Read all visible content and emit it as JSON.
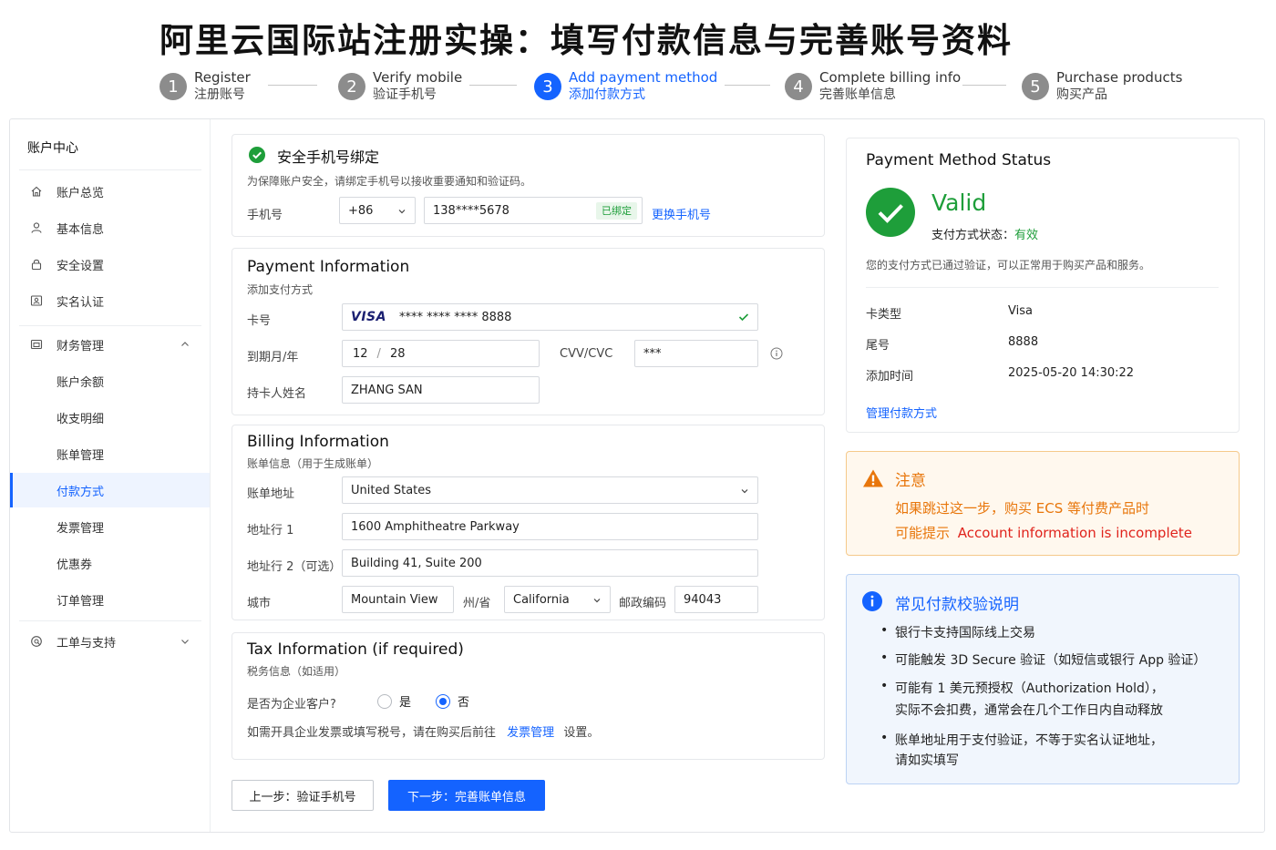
{
  "title": "阿里云国际站注册实操：填写付款信息与完善账号资料",
  "steps": [
    {
      "num": "1",
      "en": "Register",
      "cn": "注册账号"
    },
    {
      "num": "2",
      "en": "Verify mobile",
      "cn": "验证手机号"
    },
    {
      "num": "3",
      "en": "Add payment method",
      "cn": "添加付款方式"
    },
    {
      "num": "4",
      "en": "Complete billing info",
      "cn": "完善账单信息"
    },
    {
      "num": "5",
      "en": "Purchase products",
      "cn": "购买产品"
    }
  ],
  "sidebar": {
    "title": "账户中心",
    "items": [
      {
        "label": "账户总览",
        "icon": "home-icon"
      },
      {
        "label": "基本信息",
        "icon": "user-icon"
      },
      {
        "label": "安全设置",
        "icon": "lock-icon"
      },
      {
        "label": "实名认证",
        "icon": "id-card-icon"
      },
      {
        "label": "财务管理",
        "icon": "wallet-icon"
      },
      {
        "label": "账户余额"
      },
      {
        "label": "收支明细"
      },
      {
        "label": "账单管理"
      },
      {
        "label": "付款方式"
      },
      {
        "label": "发票管理"
      },
      {
        "label": "优惠券"
      },
      {
        "label": "订单管理"
      },
      {
        "label": "工单与支持",
        "icon": "support-icon"
      }
    ]
  },
  "phone": {
    "title": "安全手机号绑定",
    "desc": "为保障账户安全，请绑定手机号以接收重要通知和验证码。",
    "label": "手机号",
    "country_code": "+86",
    "number": "138****5678",
    "bound_badge": "已绑定",
    "change_link": "更换手机号"
  },
  "payment": {
    "title": "Payment Information",
    "subtitle": "添加支付方式",
    "card_label": "卡号",
    "card_brand": "VISA",
    "card_number": "**** **** **** 8888",
    "expiry_label": "到期月/年",
    "expiry_month": "12",
    "expiry_sep": "/",
    "expiry_year": "28",
    "cvv_label": "CVV/CVC",
    "cvv_value": "***",
    "holder_label": "持卡人姓名",
    "holder_value": "ZHANG SAN"
  },
  "billing": {
    "title": "Billing Information",
    "subtitle": "账单信息（用于生成账单）",
    "address_label": "账单地址",
    "country": "United States",
    "line1_label": "地址行 1",
    "line1": "1600 Amphitheatre Parkway",
    "line2_label": "地址行 2（可选）",
    "line2": "Building 41, Suite 200",
    "city_label": "城市",
    "city": "Mountain View",
    "state_label": "州/省",
    "state": "California",
    "zip_label": "邮政编码",
    "zip": "94043"
  },
  "tax": {
    "title": "Tax Information (if required)",
    "subtitle": "税务信息（如适用）",
    "question": "是否为企业客户?",
    "yes": "是",
    "no": "否",
    "selected": "否",
    "note_pre": "如需开具企业发票或填写税号，请在购买后前往",
    "note_link": "发票管理",
    "note_post": "设置。"
  },
  "buttons": {
    "prev": "上一步：验证手机号",
    "next": "下一步：完善账单信息"
  },
  "status": {
    "title": "Payment Method Status",
    "valid": "Valid",
    "state_label": "支付方式状态：",
    "state_value": "有效",
    "desc": "您的支付方式已通过验证，可以正常用于购买产品和服务。",
    "rows": [
      {
        "label": "卡类型",
        "value": "Visa"
      },
      {
        "label": "尾号",
        "value": "8888"
      },
      {
        "label": "添加时间",
        "value": "2025-05-20 14:30:22"
      }
    ],
    "manage_link": "管理付款方式"
  },
  "warning": {
    "title": "注意",
    "line1": "如果跳过这一步，购买 ECS 等付费产品时",
    "line2_pre": "可能提示",
    "line2_highlight": "Account information is incomplete"
  },
  "info": {
    "title": "常见付款校验说明",
    "items": [
      [
        "银行卡支持国际线上交易"
      ],
      [
        "可能触发 3D Secure 验证（如短信或银行 App 验证）"
      ],
      [
        "可能有 1 美元预授权（Authorization Hold），",
        "实际不会扣费，通常会在几个工作日内自动释放"
      ],
      [
        "账单地址用于支付验证，不等于实名认证地址，",
        "请如实填写"
      ]
    ]
  },
  "colors": {
    "accent": "#1463ff",
    "success": "#1e9e3a",
    "warning": "#e8760b",
    "danger": "#e0231c"
  }
}
